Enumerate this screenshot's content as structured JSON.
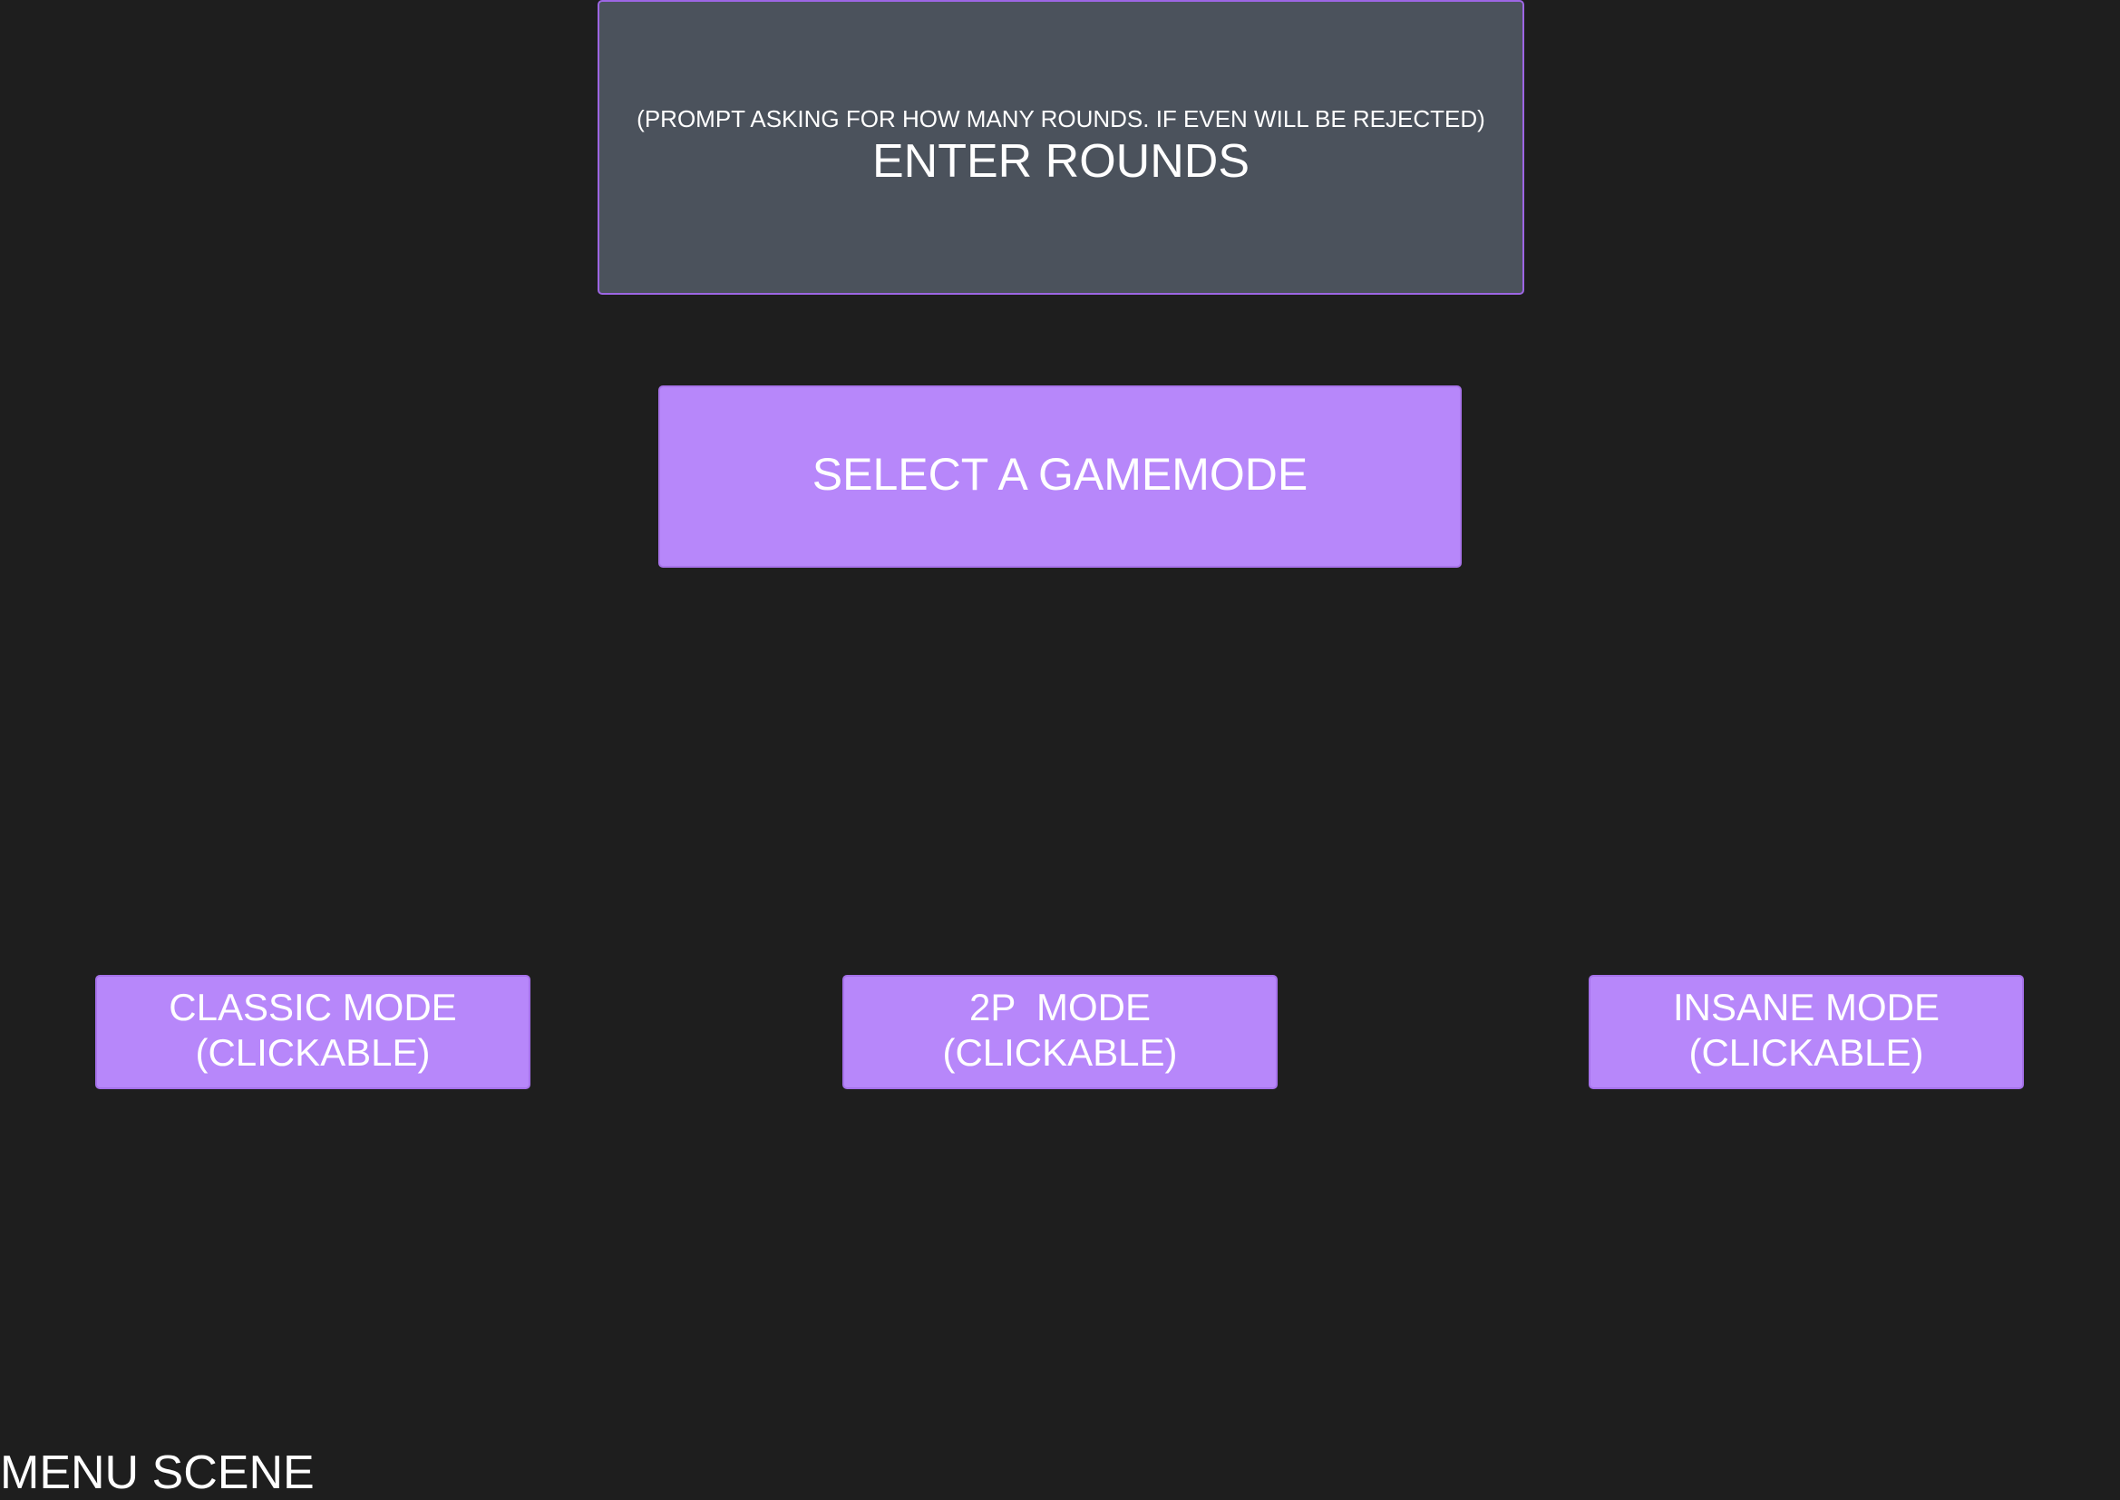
{
  "rounds_prompt": {
    "note": "(PROMPT ASKING FOR HOW MANY ROUNDS. IF EVEN WILL BE REJECTED)",
    "title": "ENTER ROUNDS"
  },
  "gamemode_header": {
    "title": "SELECT A GAMEMODE"
  },
  "modes": [
    {
      "label": "CLASSIC MODE\n(CLICKABLE)"
    },
    {
      "label": "2P  MODE\n(CLICKABLE)"
    },
    {
      "label": "INSANE MODE\n(CLICKABLE)"
    }
  ],
  "scene_label": "MENU SCENE",
  "colors": {
    "background": "#1e1e1e",
    "prompt_box": "#4b525c",
    "accent_purple": "#b787fa",
    "border_purple": "#9a62e6",
    "text": "#ffffff"
  }
}
